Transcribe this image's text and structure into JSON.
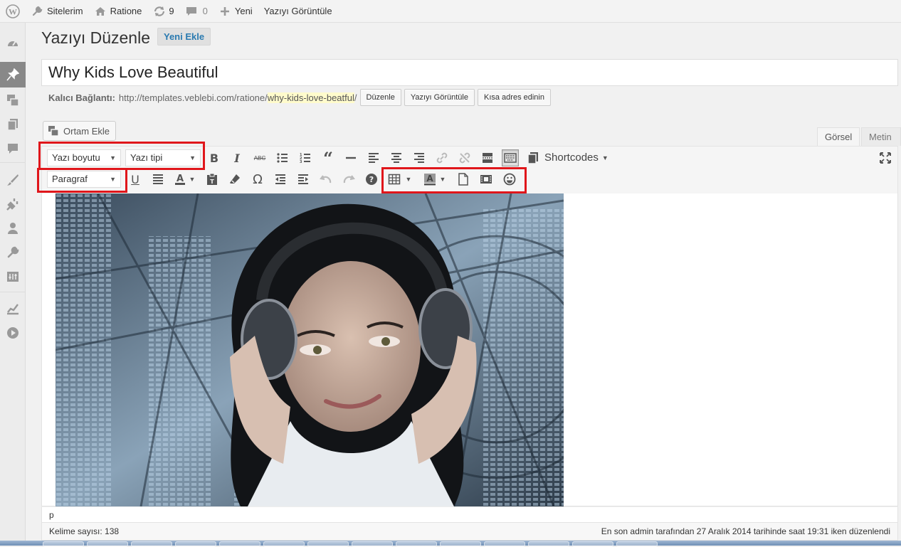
{
  "adminbar": {
    "my_sites": "Sitelerim",
    "site_name": "Ratione",
    "updates_count": "9",
    "comments_count": "0",
    "new_label": "Yeni",
    "view_post": "Yazıyı Görüntüle"
  },
  "page": {
    "title": "Yazıyı Düzenle",
    "add_new": "Yeni Ekle"
  },
  "post": {
    "title": "Why Kids Love Beautiful"
  },
  "permalink": {
    "label": "Kalıcı Bağlantı:",
    "base_url": "http://templates.veblebi.com/ratione/",
    "slug": "why-kids-love-beatful",
    "trailing": "/",
    "edit_button": "Düzenle",
    "view_button": "Yazıyı Görüntüle",
    "shortlink_button": "Kısa adres edinin"
  },
  "editor": {
    "add_media": "Ortam Ekle",
    "tab_visual": "Görsel",
    "tab_text": "Metin",
    "font_size_select": "Yazı boyutu",
    "font_family_select": "Yazı tipi",
    "format_select": "Paragraf",
    "shortcodes": "Shortcodes",
    "path": "p",
    "word_count": "Kelime sayısı: 138",
    "last_edited": "En son admin tarafından 27 Aralık 2014 tarihinde saat 19:31 iken düzenlendi"
  },
  "colors": {
    "highlight": "#e0161b",
    "link": "#2a7ab0",
    "slug_bg": "#fffbcc"
  }
}
